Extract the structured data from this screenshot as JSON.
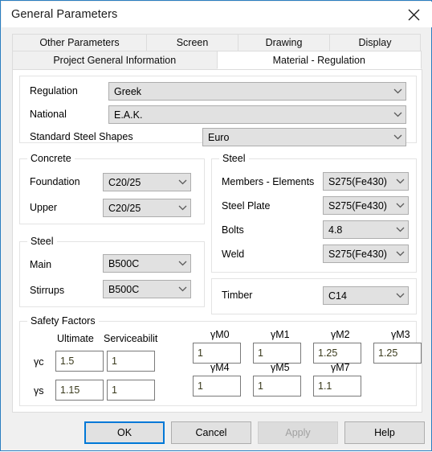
{
  "window": {
    "title": "General Parameters",
    "close_icon": "close-icon"
  },
  "tabs": {
    "row1": [
      {
        "label": "Other Parameters",
        "active": false
      },
      {
        "label": "Screen",
        "active": false
      },
      {
        "label": "Drawing",
        "active": false
      },
      {
        "label": "Display",
        "active": false
      }
    ],
    "row2": [
      {
        "label": "Project General Information",
        "active": false
      },
      {
        "label": "Material - Regulation",
        "active": true
      }
    ]
  },
  "top": {
    "regulation_label": "Regulation",
    "regulation_value": "Greek",
    "national_label": "National",
    "national_value": "E.A.K.",
    "shapes_label": "Standard Steel Shapes",
    "shapes_value": "Euro"
  },
  "concrete": {
    "title": "Concrete",
    "foundation_label": "Foundation",
    "foundation_value": "C20/25",
    "upper_label": "Upper",
    "upper_value": "C20/25"
  },
  "rebar_steel": {
    "title": "Steel",
    "main_label": "Main",
    "main_value": "B500C",
    "stirrups_label": "Stirrups",
    "stirrups_value": "B500C"
  },
  "steel": {
    "title": "Steel",
    "members_label": "Members - Elements",
    "members_value": "S275(Fe430)",
    "plate_label": "Steel Plate",
    "plate_value": "S275(Fe430)",
    "bolts_label": "Bolts",
    "bolts_value": "4.8",
    "weld_label": "Weld",
    "weld_value": "S275(Fe430)"
  },
  "timber": {
    "label": "Timber",
    "value": "C14"
  },
  "safety": {
    "title": "Safety Factors",
    "col_ultimate": "Ultimate",
    "col_serviceability": "Serviceabilit",
    "rows": [
      {
        "label": "γc",
        "ultimate": "1.5",
        "serviceability": "1"
      },
      {
        "label": "γs",
        "ultimate": "1.15",
        "serviceability": "1"
      }
    ],
    "gamma_m": [
      {
        "label": "γM0",
        "value": "1"
      },
      {
        "label": "γM1",
        "value": "1"
      },
      {
        "label": "γM2",
        "value": "1.25"
      },
      {
        "label": "γM3",
        "value": "1.25"
      },
      {
        "label": "γM4",
        "value": "1"
      },
      {
        "label": "γM5",
        "value": "1"
      },
      {
        "label": "γM7",
        "value": "1.1"
      }
    ]
  },
  "buttons": {
    "ok": "OK",
    "cancel": "Cancel",
    "apply": "Apply",
    "help": "Help"
  },
  "colors": {
    "accent": "#0078d7",
    "window_border": "#2a7ec0",
    "dialog_bg": "#f0f0f0",
    "field_bg": "#e1e1e1"
  }
}
